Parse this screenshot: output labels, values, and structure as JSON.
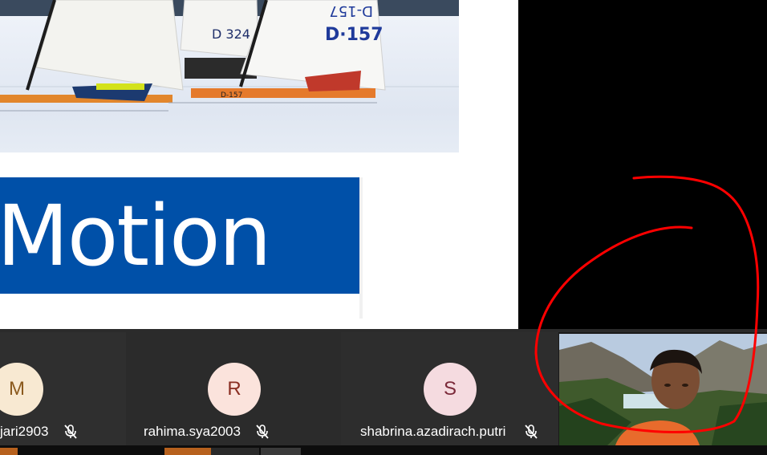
{
  "slide": {
    "photo_sail_labels": [
      "D 324",
      "D·157",
      "D-157",
      "D 324"
    ],
    "banner_text": "Motion"
  },
  "participants": [
    {
      "initial": "M",
      "name": "jari2903",
      "muted": true,
      "avatar_color": "#f8e9d2"
    },
    {
      "initial": "R",
      "name": "rahima.sya2003",
      "muted": true,
      "avatar_color": "#fbe3dc"
    },
    {
      "initial": "S",
      "name": "shabrina.azadirach.putri",
      "muted": true,
      "avatar_color": "#f5dbe0"
    }
  ],
  "video_tile": {
    "content": "camera-feed"
  },
  "colors": {
    "banner": "#0050a8",
    "strip": "#2b2b2b",
    "annotation": "#ff0000",
    "bottom_accent": "#b7611d"
  },
  "icons": {
    "mute": "mic-off-icon"
  }
}
